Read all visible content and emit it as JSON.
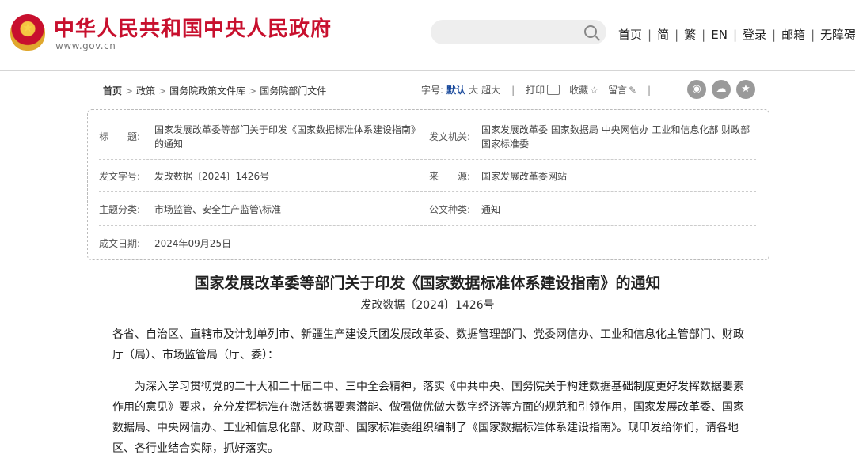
{
  "header": {
    "site_title": "中华人民共和国中央人民政府",
    "site_url": "www.gov.cn",
    "search": {
      "placeholder": ""
    },
    "nav": [
      "首页",
      "简",
      "繁",
      "EN",
      "登录",
      "邮箱",
      "无障碍"
    ],
    "separator": "|"
  },
  "breadcrumb": {
    "items": [
      "首页",
      "政策",
      "国务院政策文件库",
      "国务院部门文件"
    ],
    "arrow": ">"
  },
  "toolbar": {
    "font_size_label": "字号:",
    "font_sizes": [
      "默认",
      "大",
      "超大"
    ],
    "print": "打印",
    "favorite": "收藏",
    "comment": "留言",
    "separator": "|",
    "share_icons": [
      "weibo-icon",
      "wechat-icon",
      "favorite-share-icon"
    ]
  },
  "meta": {
    "title_label": "标　　题:",
    "title_value": "国家发展改革委等部门关于印发《国家数据标准体系建设指南》的通知",
    "issuer_label": "发文机关:",
    "issuer_value": "国家发展改革委 国家数据局 中央网信办 工业和信息化部 财政部 国家标准委",
    "docno_label": "发文字号:",
    "docno_value": "发改数据〔2024〕1426号",
    "source_label": "来　　源:",
    "source_value": "国家发展改革委网站",
    "topic_label": "主题分类:",
    "topic_value": "市场监管、安全生产监管\\标准",
    "type_label": "公文种类:",
    "type_value": "通知",
    "date_label": "成文日期:",
    "date_value": "2024年09月25日"
  },
  "article": {
    "title": "国家发展改革委等部门关于印发《国家数据标准体系建设指南》的通知",
    "doc_number": "发改数据〔2024〕1426号",
    "salutation": "各省、自治区、直辖市及计划单列市、新疆生产建设兵团发展改革委、数据管理部门、党委网信办、工业和信息化主管部门、财政厅（局）、市场监管局（厅、委）：",
    "body": "为深入学习贯彻党的二十大和二十届二中、三中全会精神，落实《中共中央、国务院关于构建数据基础制度更好发挥数据要素作用的意见》要求，充分发挥标准在激活数据要素潜能、做强做优做大数字经济等方面的规范和引领作用，国家发展改革委、国家数据局、中央网信办、工业和信息化部、财政部、国家标准委组织编制了《国家数据标准体系建设指南》。现印发给你们，请各地区、各行业结合实际，抓好落实。"
  },
  "colors": {
    "brand_red": "#c8102e",
    "active_blue": "#1a4a9c"
  }
}
